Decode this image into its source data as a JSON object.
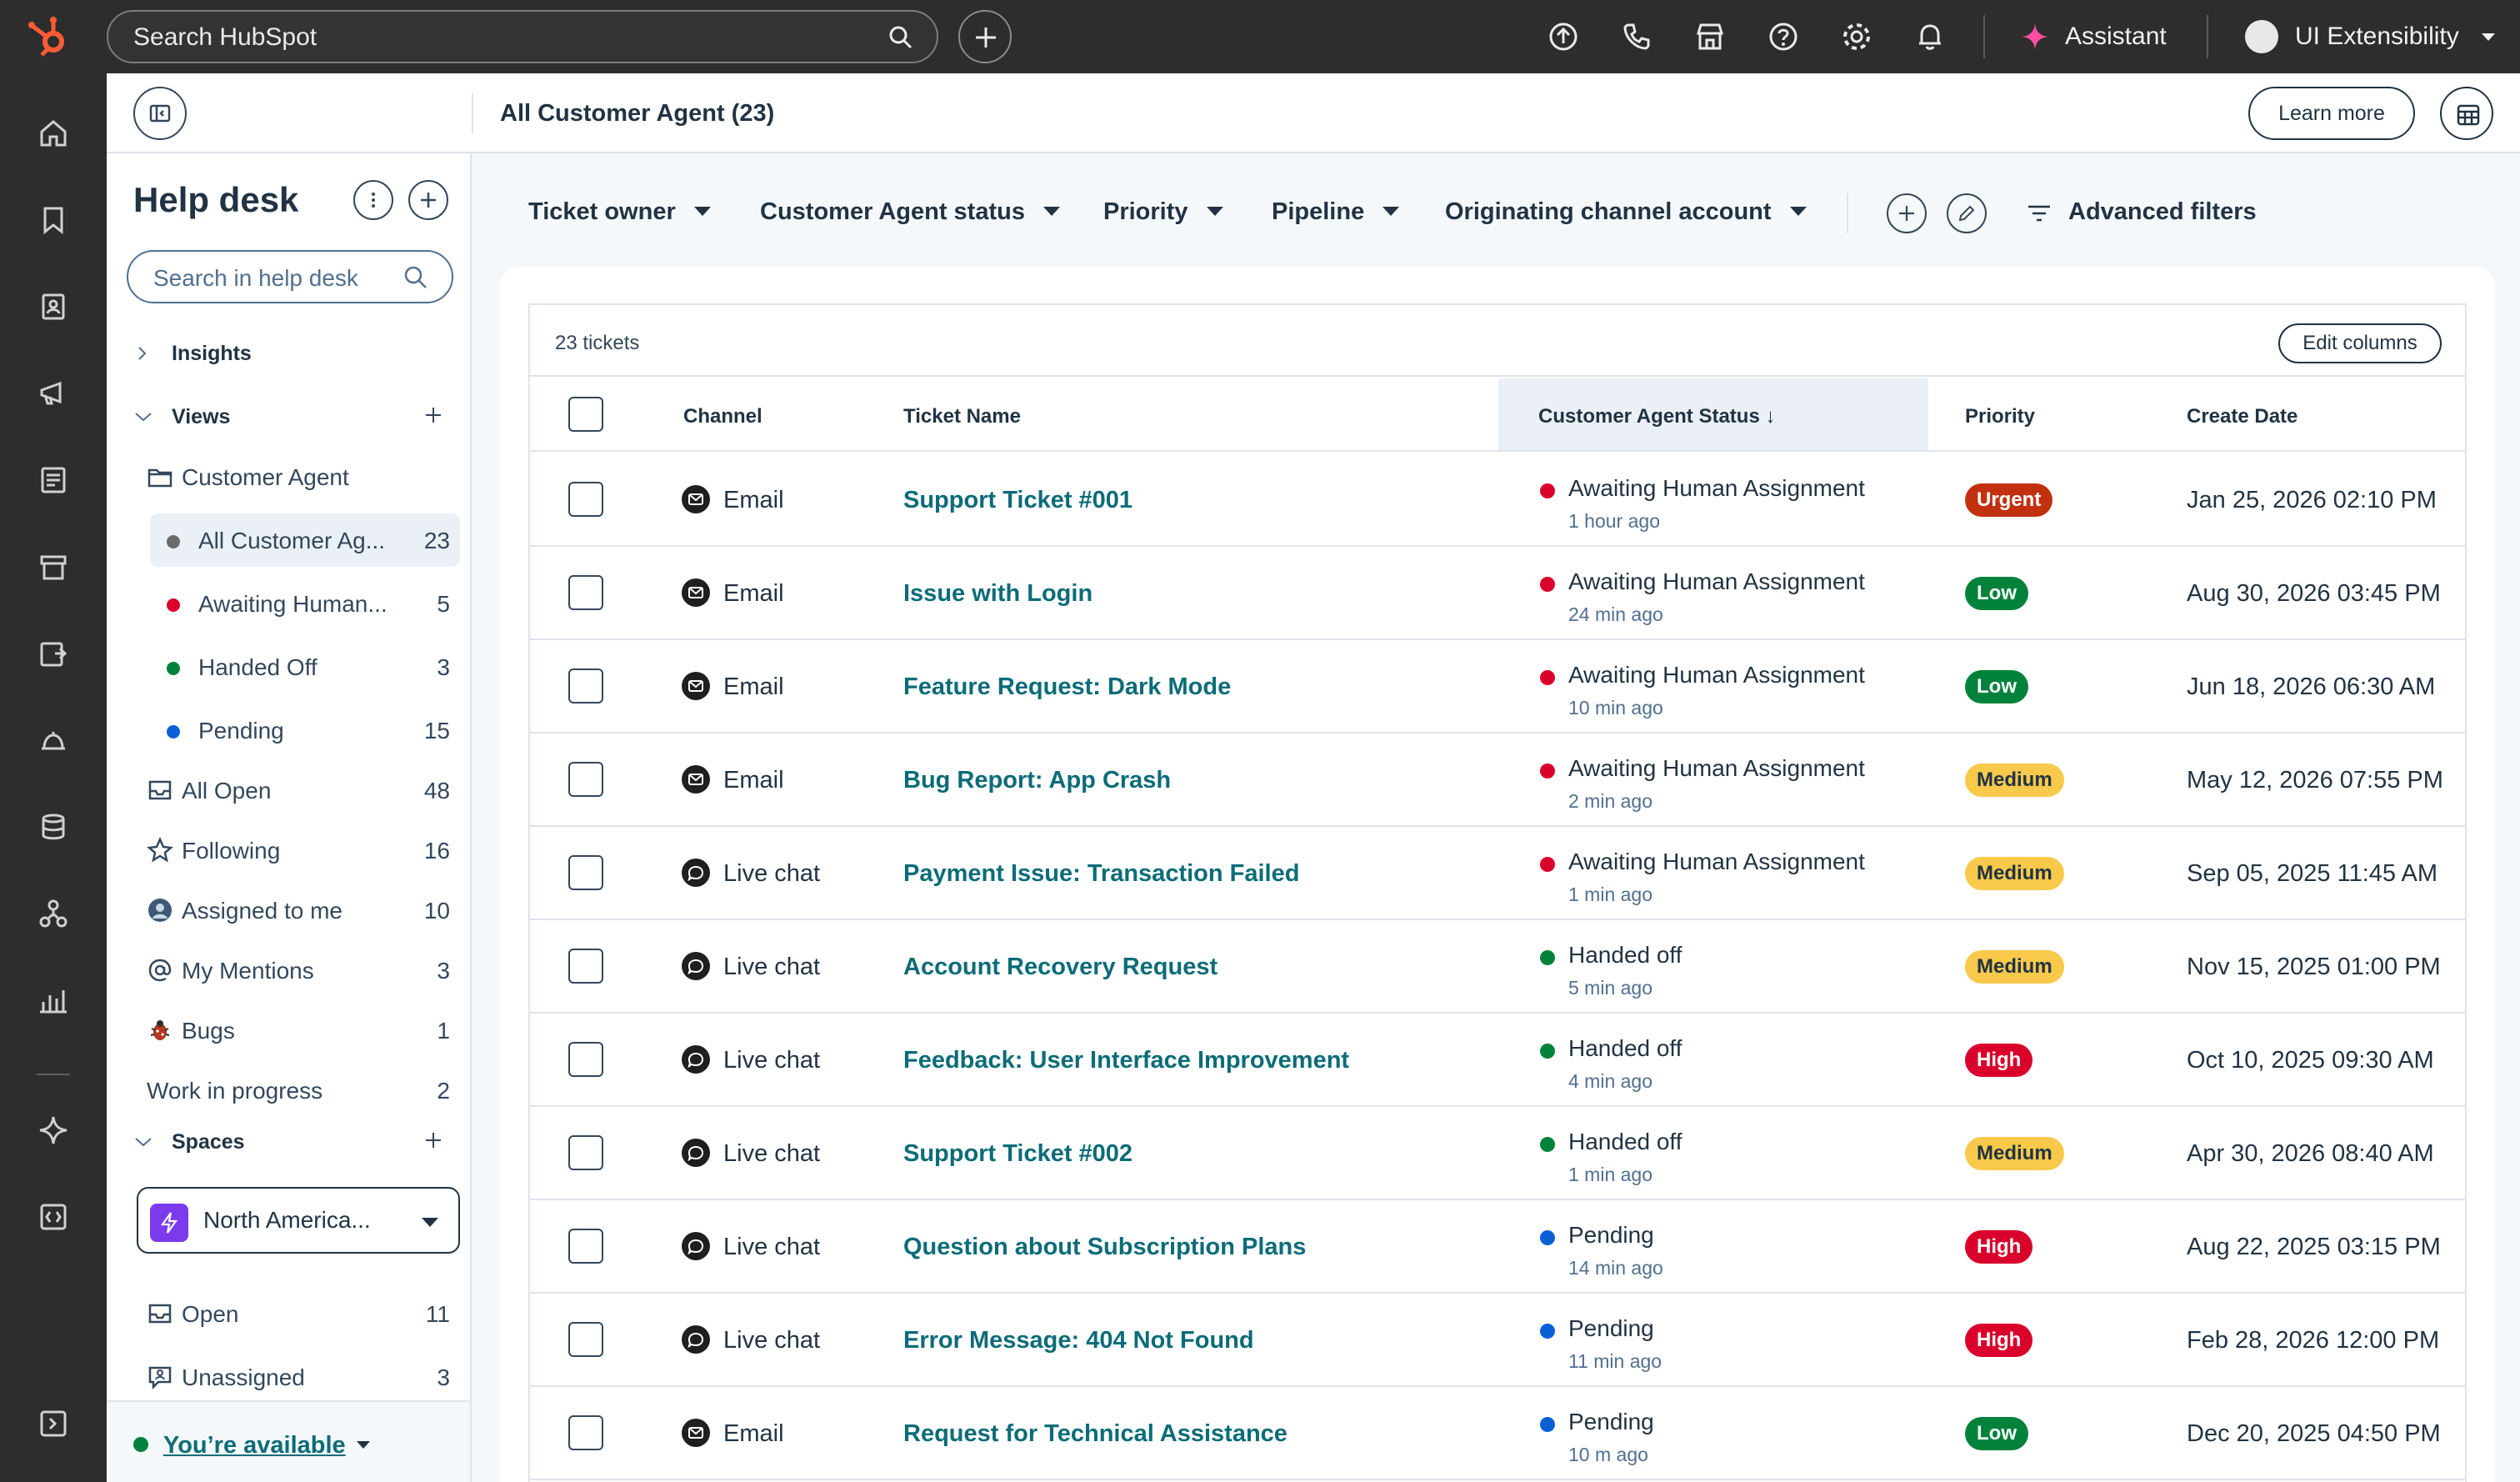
{
  "topbar": {
    "search_placeholder": "Search HubSpot",
    "assistant_label": "Assistant",
    "account_name": "UI Extensibility",
    "icons": [
      "upgrade-icon",
      "calling-icon",
      "marketplace-icon",
      "help-icon",
      "settings-icon",
      "notifications-icon"
    ]
  },
  "leftnav": {
    "icons": [
      "home-icon",
      "bookmark-icon",
      "contacts-icon",
      "marketing-icon",
      "content-icon",
      "commerce-icon",
      "automation-icon",
      "service-icon",
      "data-icon",
      "development-icon",
      "reports-icon",
      "breeze-icon",
      "app-objects-icon"
    ]
  },
  "header": {
    "title": "All Customer Agent (23)",
    "learn_more": "Learn more"
  },
  "sidebar": {
    "title": "Help desk",
    "search_placeholder": "Search in help desk",
    "insights_label": "Insights",
    "views_label": "Views",
    "spaces_label": "Spaces",
    "views": [
      {
        "label": "Customer Agent",
        "count": "",
        "icon": "folder-icon"
      },
      {
        "label": "All Customer Ag...",
        "count": "23",
        "dot": "#6b6b6b"
      },
      {
        "label": "Awaiting Human...",
        "count": "5",
        "dot": "#d9002b"
      },
      {
        "label": "Handed Off",
        "count": "3",
        "dot": "#00823a"
      },
      {
        "label": "Pending",
        "count": "15",
        "dot": "#0b60d8"
      },
      {
        "label": "All Open",
        "count": "48",
        "icon": "inbox-icon"
      },
      {
        "label": "Following",
        "count": "16",
        "icon": "star-icon"
      },
      {
        "label": "Assigned to me",
        "count": "10",
        "icon": "avatar-icon"
      },
      {
        "label": "My Mentions",
        "count": "3",
        "icon": "at-icon"
      },
      {
        "label": "Bugs",
        "count": "1",
        "icon": "bug-icon"
      },
      {
        "label": "Work in progress",
        "count": "2",
        "icon": ""
      }
    ],
    "space_selected": "North America...",
    "spaces": [
      {
        "label": "Open",
        "count": "11",
        "icon": "inbox-icon"
      },
      {
        "label": "Unassigned",
        "count": "3",
        "icon": "unassigned-icon"
      }
    ],
    "availability": "You’re available"
  },
  "filters": {
    "items": [
      "Ticket owner",
      "Customer Agent status",
      "Priority",
      "Pipeline",
      "Originating channel account"
    ],
    "advanced": "Advanced filters"
  },
  "table": {
    "count_label": "23 tickets",
    "edit_columns": "Edit columns",
    "columns": {
      "channel": "Channel",
      "ticket_name": "Ticket Name",
      "status": "Customer Agent Status",
      "priority": "Priority",
      "create_date": "Create Date"
    },
    "sort_indicator": "↓",
    "rows": [
      {
        "channel": "Email",
        "name": "Support Ticket #001",
        "status": "Awaiting Human Assignment",
        "ago": "1 hour ago",
        "priority": "Urgent",
        "date": "Jan 25, 2026 02:10 PM"
      },
      {
        "channel": "Email",
        "name": "Issue with Login",
        "status": "Awaiting Human Assignment",
        "ago": "24 min ago",
        "priority": "Low",
        "date": "Aug 30, 2026 03:45 PM"
      },
      {
        "channel": "Email",
        "name": "Feature Request: Dark Mode",
        "status": "Awaiting Human Assignment",
        "ago": "10 min ago",
        "priority": "Low",
        "date": "Jun 18, 2026 06:30 AM"
      },
      {
        "channel": "Email",
        "name": "Bug Report: App Crash",
        "status": "Awaiting Human Assignment",
        "ago": "2 min ago",
        "priority": "Medium",
        "date": "May 12, 2026 07:55 PM"
      },
      {
        "channel": "Live chat",
        "name": "Payment Issue: Transaction Failed",
        "status": "Awaiting Human Assignment",
        "ago": "1 min ago",
        "priority": "Medium",
        "date": "Sep 05, 2025 11:45 AM"
      },
      {
        "channel": "Live chat",
        "name": "Account Recovery Request",
        "status": "Handed off",
        "ago": "5 min ago",
        "priority": "Medium",
        "date": "Nov 15, 2025 01:00 PM"
      },
      {
        "channel": "Live chat",
        "name": "Feedback: User Interface Improvement",
        "status": "Handed off",
        "ago": "4 min ago",
        "priority": "High",
        "date": "Oct 10, 2025 09:30 AM"
      },
      {
        "channel": "Live chat",
        "name": "Support Ticket #002",
        "status": "Handed off",
        "ago": "1 min ago",
        "priority": "Medium",
        "date": "Apr 30, 2026 08:40 AM"
      },
      {
        "channel": "Live chat",
        "name": "Question about Subscription Plans",
        "status": "Pending",
        "ago": "14 min ago",
        "priority": "High",
        "date": "Aug 22, 2025 03:15 PM"
      },
      {
        "channel": "Live chat",
        "name": "Error Message: 404 Not Found",
        "status": "Pending",
        "ago": "11 min ago",
        "priority": "High",
        "date": "Feb 28, 2026 12:00 PM"
      },
      {
        "channel": "Email",
        "name": "Request for Technical Assistance",
        "status": "Pending",
        "ago": "10 m ago",
        "priority": "Low",
        "date": "Dec 20, 2025 04:50 PM"
      }
    ]
  },
  "colors": {
    "status": {
      "Awaiting Human Assignment": "#d9002b",
      "Handed off": "#00823a",
      "Pending": "#0b60d8"
    },
    "priority": {
      "Urgent": {
        "bg": "#c2310f",
        "fg": "#ffffff"
      },
      "High": {
        "bg": "#d9002b",
        "fg": "#ffffff"
      },
      "Medium": {
        "bg": "#f8c94a",
        "fg": "#213343"
      },
      "Low": {
        "bg": "#00823a",
        "fg": "#ffffff"
      }
    },
    "link": "#0b6c78",
    "brand": "#ff5c35"
  }
}
